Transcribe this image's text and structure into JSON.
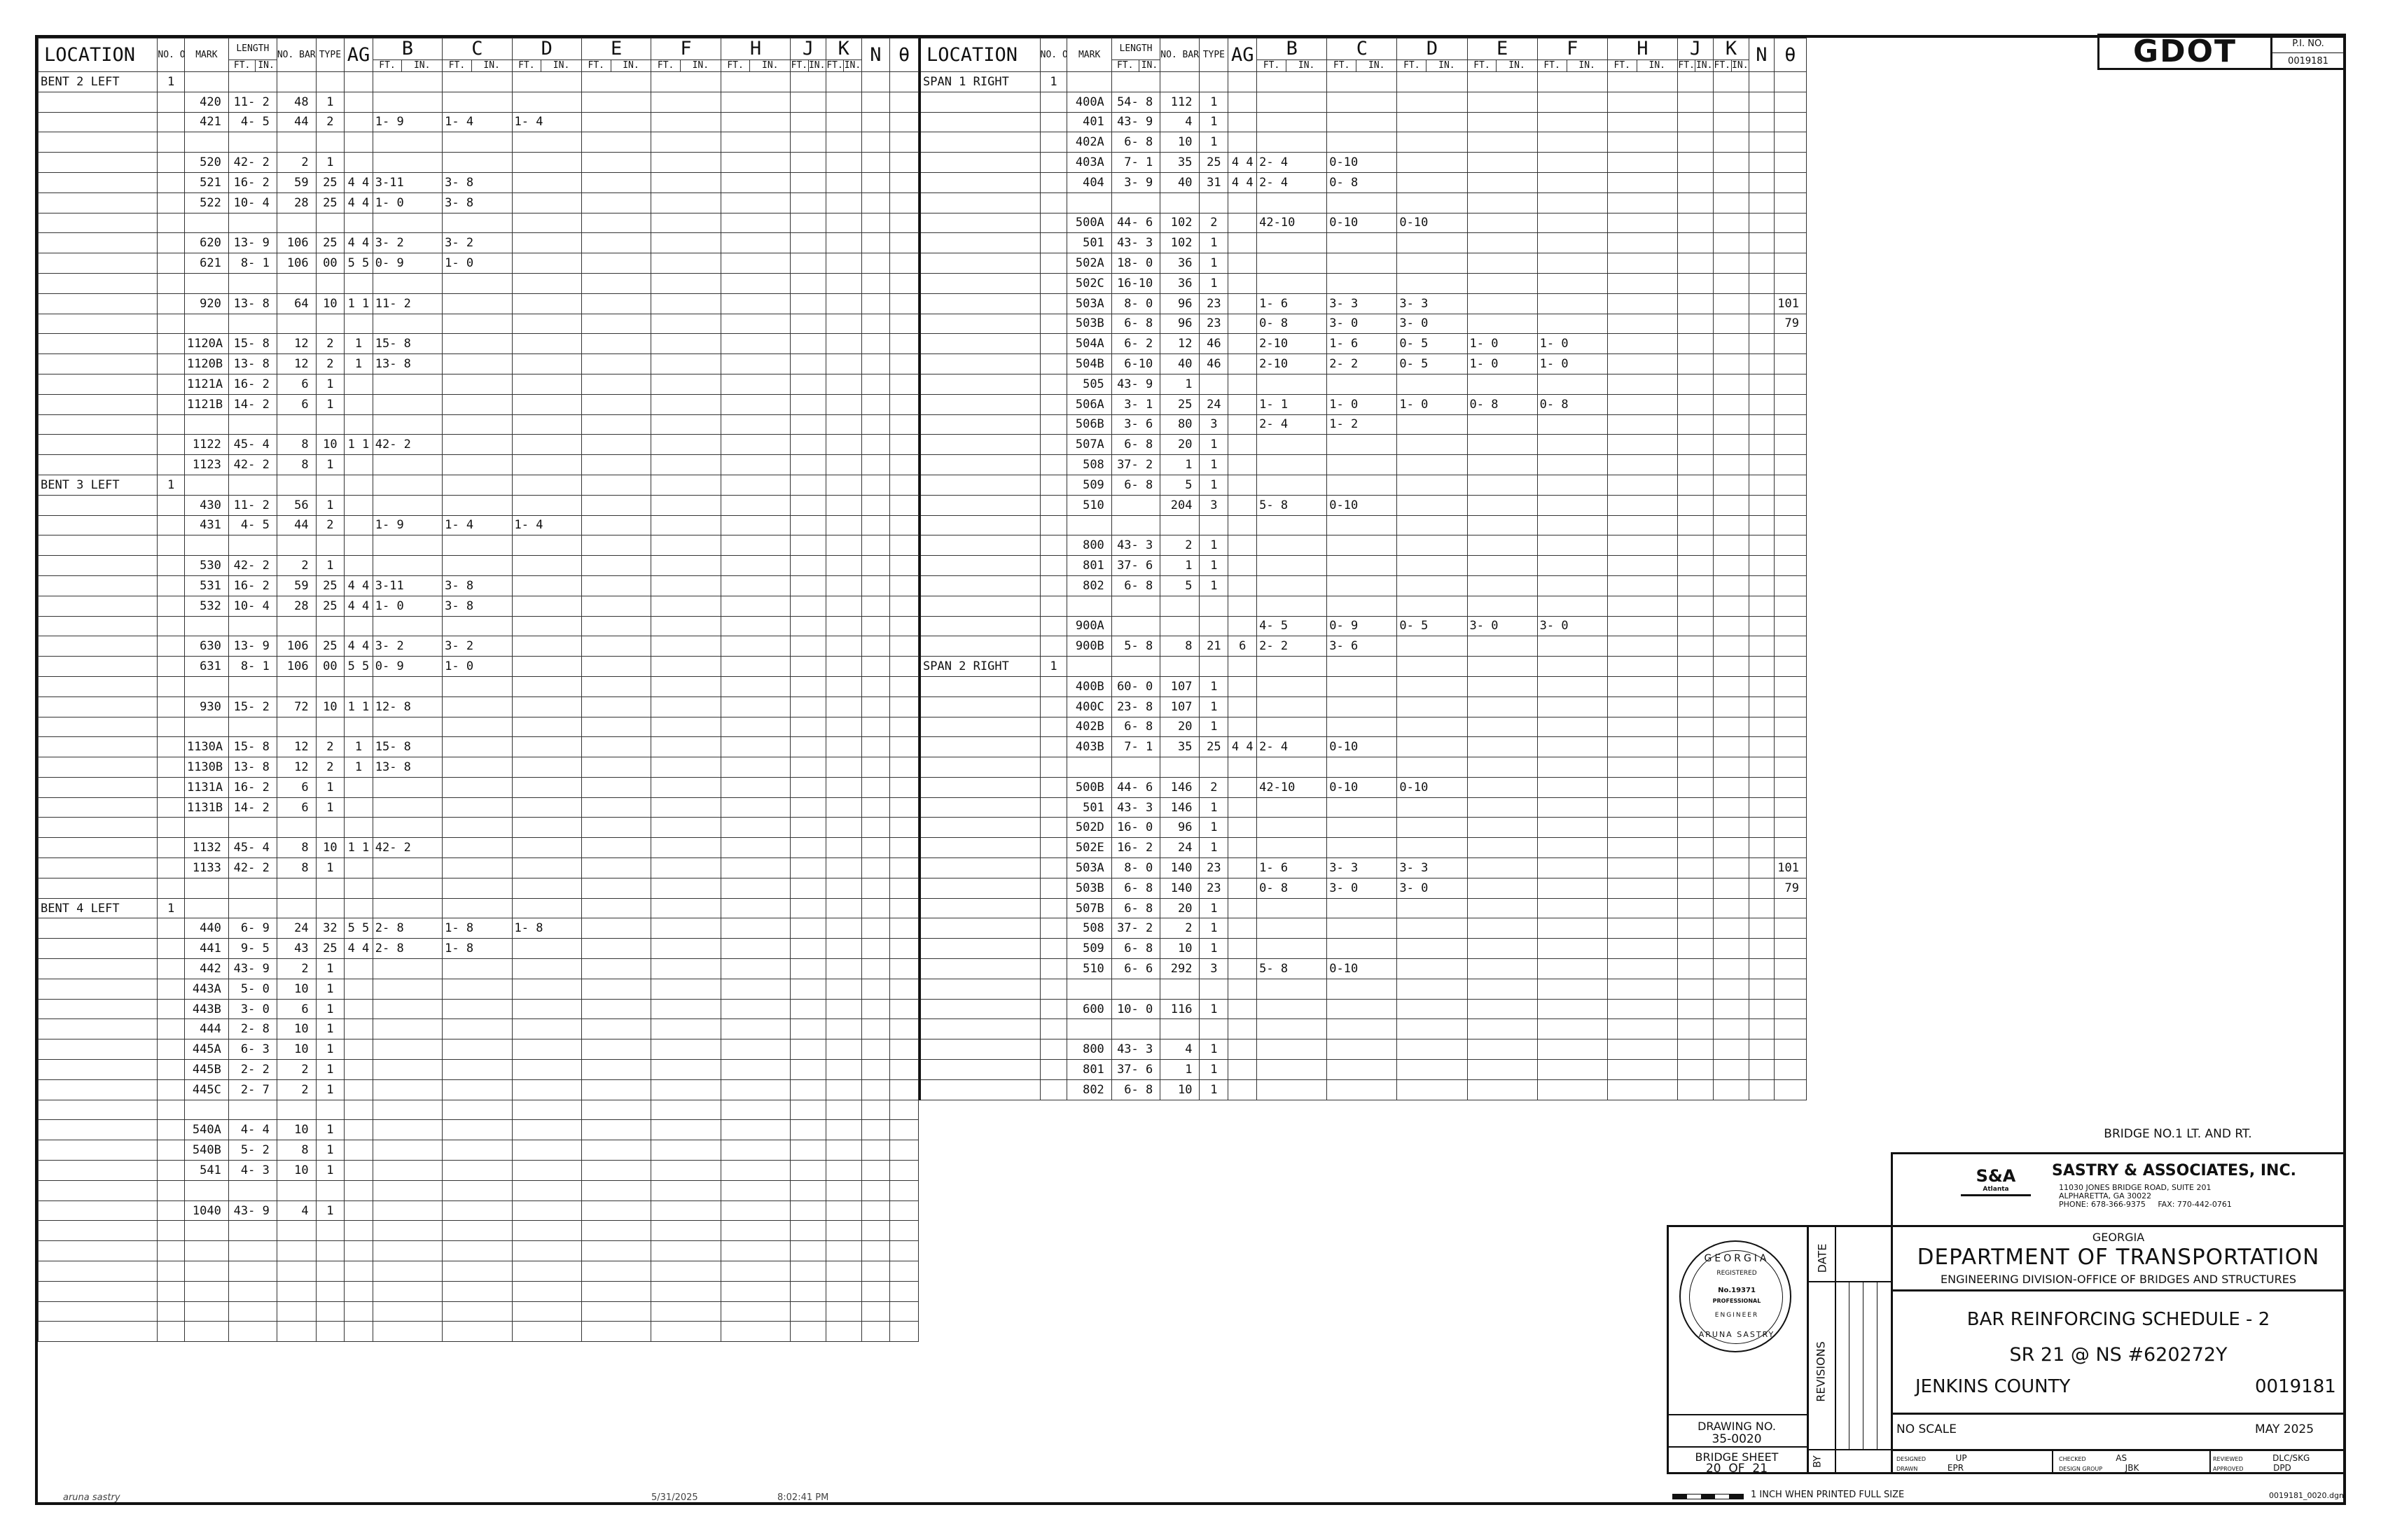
{
  "header": {
    "location": "LOCATION",
    "no_of_loc": "NO. OF LOC.",
    "mark": "MARK",
    "length": "LENGTH",
    "ft": "FT.",
    "in": "IN.",
    "no_bars": "NO. BARS REQ'D.",
    "type": "TYPE",
    "ag": "AG",
    "cols": [
      "B",
      "C",
      "D",
      "E",
      "F",
      "H",
      "J",
      "K"
    ],
    "n": "N",
    "theta": "θ"
  },
  "left_rows": [
    [
      "BENT 2 LEFT",
      "1",
      "",
      "",
      "",
      "",
      "",
      "",
      "",
      ""
    ],
    [
      "",
      "",
      "420",
      "11- 2",
      "48",
      "1",
      "",
      "",
      "",
      ""
    ],
    [
      "",
      "",
      "421",
      "4- 5",
      "44",
      "2",
      "",
      "1- 9",
      "1- 4",
      "1- 4"
    ],
    [
      "",
      "",
      "",
      "",
      "",
      "",
      "",
      "",
      "",
      ""
    ],
    [
      "",
      "",
      "520",
      "42- 2",
      "2",
      "1",
      "",
      "",
      "",
      ""
    ],
    [
      "",
      "",
      "521",
      "16- 2",
      "59",
      "25",
      "4 4",
      "3-11",
      "3- 8",
      ""
    ],
    [
      "",
      "",
      "522",
      "10- 4",
      "28",
      "25",
      "4 4",
      "1- 0",
      "3- 8",
      ""
    ],
    [
      "",
      "",
      "",
      "",
      "",
      "",
      "",
      "",
      "",
      ""
    ],
    [
      "",
      "",
      "620",
      "13- 9",
      "106",
      "25",
      "4 4",
      "3- 2",
      "3- 2",
      ""
    ],
    [
      "",
      "",
      "621",
      "8- 1",
      "106",
      "00",
      "5 5",
      "0- 9",
      "1- 0",
      ""
    ],
    [
      "",
      "",
      "",
      "",
      "",
      "",
      "",
      "",
      "",
      ""
    ],
    [
      "",
      "",
      "920",
      "13- 8",
      "64",
      "10",
      "1 1",
      "11- 2",
      "",
      ""
    ],
    [
      "",
      "",
      "",
      "",
      "",
      "",
      "",
      "",
      "",
      ""
    ],
    [
      "",
      "",
      "1120A",
      "15- 8",
      "12",
      "2",
      "1",
      "15- 8",
      "",
      ""
    ],
    [
      "",
      "",
      "1120B",
      "13- 8",
      "12",
      "2",
      "1",
      "13- 8",
      "",
      ""
    ],
    [
      "",
      "",
      "1121A",
      "16- 2",
      "6",
      "1",
      "",
      "",
      "",
      ""
    ],
    [
      "",
      "",
      "1121B",
      "14- 2",
      "6",
      "1",
      "",
      "",
      "",
      ""
    ],
    [
      "",
      "",
      "",
      "",
      "",
      "",
      "",
      "",
      "",
      ""
    ],
    [
      "",
      "",
      "1122",
      "45- 4",
      "8",
      "10",
      "1 1",
      "42- 2",
      "",
      ""
    ],
    [
      "",
      "",
      "1123",
      "42- 2",
      "8",
      "1",
      "",
      "",
      "",
      ""
    ],
    [
      "BENT 3 LEFT",
      "1",
      "",
      "",
      "",
      "",
      "",
      "",
      "",
      ""
    ],
    [
      "",
      "",
      "430",
      "11- 2",
      "56",
      "1",
      "",
      "",
      "",
      ""
    ],
    [
      "",
      "",
      "431",
      "4- 5",
      "44",
      "2",
      "",
      "1- 9",
      "1- 4",
      "1- 4"
    ],
    [
      "",
      "",
      "",
      "",
      "",
      "",
      "",
      "",
      "",
      ""
    ],
    [
      "",
      "",
      "530",
      "42- 2",
      "2",
      "1",
      "",
      "",
      "",
      ""
    ],
    [
      "",
      "",
      "531",
      "16- 2",
      "59",
      "25",
      "4 4",
      "3-11",
      "3- 8",
      ""
    ],
    [
      "",
      "",
      "532",
      "10- 4",
      "28",
      "25",
      "4 4",
      "1- 0",
      "3- 8",
      ""
    ],
    [
      "",
      "",
      "",
      "",
      "",
      "",
      "",
      "",
      "",
      ""
    ],
    [
      "",
      "",
      "630",
      "13- 9",
      "106",
      "25",
      "4 4",
      "3- 2",
      "3- 2",
      ""
    ],
    [
      "",
      "",
      "631",
      "8- 1",
      "106",
      "00",
      "5 5",
      "0- 9",
      "1- 0",
      ""
    ],
    [
      "",
      "",
      "",
      "",
      "",
      "",
      "",
      "",
      "",
      ""
    ],
    [
      "",
      "",
      "930",
      "15- 2",
      "72",
      "10",
      "1 1",
      "12- 8",
      "",
      ""
    ],
    [
      "",
      "",
      "",
      "",
      "",
      "",
      "",
      "",
      "",
      ""
    ],
    [
      "",
      "",
      "1130A",
      "15- 8",
      "12",
      "2",
      "1",
      "15- 8",
      "",
      ""
    ],
    [
      "",
      "",
      "1130B",
      "13- 8",
      "12",
      "2",
      "1",
      "13- 8",
      "",
      ""
    ],
    [
      "",
      "",
      "1131A",
      "16- 2",
      "6",
      "1",
      "",
      "",
      "",
      ""
    ],
    [
      "",
      "",
      "1131B",
      "14- 2",
      "6",
      "1",
      "",
      "",
      "",
      ""
    ],
    [
      "",
      "",
      "",
      "",
      "",
      "",
      "",
      "",
      "",
      ""
    ],
    [
      "",
      "",
      "1132",
      "45- 4",
      "8",
      "10",
      "1 1",
      "42- 2",
      "",
      ""
    ],
    [
      "",
      "",
      "1133",
      "42- 2",
      "8",
      "1",
      "",
      "",
      "",
      ""
    ],
    [
      "",
      "",
      "",
      "",
      "",
      "",
      "",
      "",
      "",
      ""
    ],
    [
      "BENT 4 LEFT",
      "1",
      "",
      "",
      "",
      "",
      "",
      "",
      "",
      ""
    ],
    [
      "",
      "",
      "440",
      "6- 9",
      "24",
      "32",
      "5 5",
      "2- 8",
      "1- 8",
      "1- 8"
    ],
    [
      "",
      "",
      "441",
      "9- 5",
      "43",
      "25",
      "4 4",
      "2- 8",
      "1- 8",
      ""
    ],
    [
      "",
      "",
      "442",
      "43- 9",
      "2",
      "1",
      "",
      "",
      "",
      ""
    ],
    [
      "",
      "",
      "443A",
      "5- 0",
      "10",
      "1",
      "",
      "",
      "",
      ""
    ],
    [
      "",
      "",
      "443B",
      "3- 0",
      "6",
      "1",
      "",
      "",
      "",
      ""
    ],
    [
      "",
      "",
      "444",
      "2- 8",
      "10",
      "1",
      "",
      "",
      "",
      ""
    ],
    [
      "",
      "",
      "445A",
      "6- 3",
      "10",
      "1",
      "",
      "",
      "",
      ""
    ],
    [
      "",
      "",
      "445B",
      "2- 2",
      "2",
      "1",
      "",
      "",
      "",
      ""
    ],
    [
      "",
      "",
      "445C",
      "2- 7",
      "2",
      "1",
      "",
      "",
      "",
      ""
    ],
    [
      "",
      "",
      "",
      "",
      "",
      "",
      "",
      "",
      "",
      ""
    ],
    [
      "",
      "",
      "540A",
      "4- 4",
      "10",
      "1",
      "",
      "",
      "",
      ""
    ],
    [
      "",
      "",
      "540B",
      "5- 2",
      "8",
      "1",
      "",
      "",
      "",
      ""
    ],
    [
      "",
      "",
      "541",
      "4- 3",
      "10",
      "1",
      "",
      "",
      "",
      ""
    ],
    [
      "",
      "",
      "",
      "",
      "",
      "",
      "",
      "",
      "",
      ""
    ],
    [
      "",
      "",
      "1040",
      "43- 9",
      "4",
      "1",
      "",
      "",
      "",
      ""
    ],
    [
      "",
      "",
      "",
      "",
      "",
      "",
      "",
      "",
      "",
      ""
    ],
    [
      "",
      "",
      "",
      "",
      "",
      "",
      "",
      "",
      "",
      ""
    ],
    [
      "",
      "",
      "",
      "",
      "",
      "",
      "",
      "",
      "",
      ""
    ],
    [
      "",
      "",
      "",
      "",
      "",
      "",
      "",
      "",
      "",
      ""
    ],
    [
      "",
      "",
      "",
      "",
      "",
      "",
      "",
      "",
      "",
      ""
    ],
    [
      "",
      "",
      "",
      "",
      "",
      "",
      "",
      "",
      "",
      ""
    ]
  ],
  "right_rows": [
    [
      "SPAN 1 RIGHT",
      "1",
      "",
      "",
      "",
      "",
      "",
      "",
      "",
      "",
      "",
      "",
      "",
      ""
    ],
    [
      "",
      "",
      "400A",
      "54- 8",
      "112",
      "1",
      "",
      "",
      "",
      "",
      "",
      "",
      "",
      ""
    ],
    [
      "",
      "",
      "401",
      "43- 9",
      "4",
      "1",
      "",
      "",
      "",
      "",
      "",
      "",
      "",
      ""
    ],
    [
      "",
      "",
      "402A",
      "6- 8",
      "10",
      "1",
      "",
      "",
      "",
      "",
      "",
      "",
      "",
      ""
    ],
    [
      "",
      "",
      "403A",
      "7- 1",
      "35",
      "25",
      "4 4",
      "2- 4",
      "0-10",
      "",
      "",
      "",
      "",
      ""
    ],
    [
      "",
      "",
      "404",
      "3- 9",
      "40",
      "31",
      "4 4",
      "2- 4",
      "0- 8",
      "",
      "",
      "",
      "",
      ""
    ],
    [
      "",
      "",
      "",
      "",
      "",
      "",
      "",
      "",
      "",
      "",
      "",
      "",
      "",
      ""
    ],
    [
      "",
      "",
      "500A",
      "44- 6",
      "102",
      "2",
      "",
      "42-10",
      "0-10",
      "0-10",
      "",
      "",
      "",
      ""
    ],
    [
      "",
      "",
      "501",
      "43- 3",
      "102",
      "1",
      "",
      "",
      "",
      "",
      "",
      "",
      "",
      ""
    ],
    [
      "",
      "",
      "502A",
      "18- 0",
      "36",
      "1",
      "",
      "",
      "",
      "",
      "",
      "",
      "",
      ""
    ],
    [
      "",
      "",
      "502C",
      "16-10",
      "36",
      "1",
      "",
      "",
      "",
      "",
      "",
      "",
      "",
      ""
    ],
    [
      "",
      "",
      "503A",
      "8- 0",
      "96",
      "23",
      "",
      "1- 6",
      "3- 3",
      "3- 3",
      "",
      "",
      "",
      "101"
    ],
    [
      "",
      "",
      "503B",
      "6- 8",
      "96",
      "23",
      "",
      "0- 8",
      "3- 0",
      "3- 0",
      "",
      "",
      "",
      "79"
    ],
    [
      "",
      "",
      "504A",
      "6- 2",
      "12",
      "46",
      "",
      "2-10",
      "1- 6",
      "0- 5",
      "1- 0",
      "1- 0",
      "",
      ""
    ],
    [
      "",
      "",
      "504B",
      "6-10",
      "40",
      "46",
      "",
      "2-10",
      "2- 2",
      "0- 5",
      "1- 0",
      "1- 0",
      "",
      ""
    ],
    [
      "",
      "",
      "505",
      "43- 9",
      "1",
      "",
      "",
      "",
      "",
      "",
      "",
      "",
      "",
      ""
    ],
    [
      "",
      "",
      "506A",
      "3- 1",
      "25",
      "24",
      "",
      "1- 1",
      "1- 0",
      "1- 0",
      "0- 8",
      "0- 8",
      "",
      ""
    ],
    [
      "",
      "",
      "506B",
      "3- 6",
      "80",
      "3",
      "",
      "2- 4",
      "1- 2",
      "",
      "",
      "",
      "",
      ""
    ],
    [
      "",
      "",
      "507A",
      "6- 8",
      "20",
      "1",
      "",
      "",
      "",
      "",
      "",
      "",
      "",
      ""
    ],
    [
      "",
      "",
      "508",
      "37- 2",
      "1",
      "1",
      "",
      "",
      "",
      "",
      "",
      "",
      "",
      ""
    ],
    [
      "",
      "",
      "509",
      "6- 8",
      "5",
      "1",
      "",
      "",
      "",
      "",
      "",
      "",
      "",
      ""
    ],
    [
      "",
      "",
      "510",
      "",
      "204",
      "3",
      "",
      "5- 8",
      "0-10",
      "",
      "",
      "",
      "",
      ""
    ],
    [
      "",
      "",
      "",
      "",
      "",
      "",
      "",
      "",
      "",
      "",
      "",
      "",
      "",
      ""
    ],
    [
      "",
      "",
      "800",
      "43- 3",
      "2",
      "1",
      "",
      "",
      "",
      "",
      "",
      "",
      "",
      ""
    ],
    [
      "",
      "",
      "801",
      "37- 6",
      "1",
      "1",
      "",
      "",
      "",
      "",
      "",
      "",
      "",
      ""
    ],
    [
      "",
      "",
      "802",
      "6- 8",
      "5",
      "1",
      "",
      "",
      "",
      "",
      "",
      "",
      "",
      ""
    ],
    [
      "",
      "",
      "",
      "",
      "",
      "",
      "",
      "",
      "",
      "",
      "",
      "",
      "",
      ""
    ],
    [
      "",
      "",
      "900A",
      "",
      "",
      "",
      "",
      "4- 5",
      "0- 9",
      "0- 5",
      "3- 0",
      "3- 0",
      "",
      ""
    ],
    [
      "",
      "",
      "900B",
      "5- 8",
      "8",
      "21",
      "6",
      "2- 2",
      "3- 6",
      "",
      "",
      "",
      "",
      ""
    ],
    [
      "SPAN 2 RIGHT",
      "1",
      "",
      "",
      "",
      "",
      "",
      "",
      "",
      "",
      "",
      "",
      "",
      ""
    ],
    [
      "",
      "",
      "400B",
      "60- 0",
      "107",
      "1",
      "",
      "",
      "",
      "",
      "",
      "",
      "",
      ""
    ],
    [
      "",
      "",
      "400C",
      "23- 8",
      "107",
      "1",
      "",
      "",
      "",
      "",
      "",
      "",
      "",
      ""
    ],
    [
      "",
      "",
      "402B",
      "6- 8",
      "20",
      "1",
      "",
      "",
      "",
      "",
      "",
      "",
      "",
      ""
    ],
    [
      "",
      "",
      "403B",
      "7- 1",
      "35",
      "25",
      "4 4",
      "2- 4",
      "0-10",
      "",
      "",
      "",
      "",
      ""
    ],
    [
      "",
      "",
      "",
      "",
      "",
      "",
      "",
      "",
      "",
      "",
      "",
      "",
      "",
      ""
    ],
    [
      "",
      "",
      "500B",
      "44- 6",
      "146",
      "2",
      "",
      "42-10",
      "0-10",
      "0-10",
      "",
      "",
      "",
      ""
    ],
    [
      "",
      "",
      "501",
      "43- 3",
      "146",
      "1",
      "",
      "",
      "",
      "",
      "",
      "",
      "",
      ""
    ],
    [
      "",
      "",
      "502D",
      "16- 0",
      "96",
      "1",
      "",
      "",
      "",
      "",
      "",
      "",
      "",
      ""
    ],
    [
      "",
      "",
      "502E",
      "16- 2",
      "24",
      "1",
      "",
      "",
      "",
      "",
      "",
      "",
      "",
      ""
    ],
    [
      "",
      "",
      "503A",
      "8- 0",
      "140",
      "23",
      "",
      "1- 6",
      "3- 3",
      "3- 3",
      "",
      "",
      "",
      "101"
    ],
    [
      "",
      "",
      "503B",
      "6- 8",
      "140",
      "23",
      "",
      "0- 8",
      "3- 0",
      "3- 0",
      "",
      "",
      "",
      "79"
    ],
    [
      "",
      "",
      "507B",
      "6- 8",
      "20",
      "1",
      "",
      "",
      "",
      "",
      "",
      "",
      "",
      ""
    ],
    [
      "",
      "",
      "508",
      "37- 2",
      "2",
      "1",
      "",
      "",
      "",
      "",
      "",
      "",
      "",
      ""
    ],
    [
      "",
      "",
      "509",
      "6- 8",
      "10",
      "1",
      "",
      "",
      "",
      "",
      "",
      "",
      "",
      ""
    ],
    [
      "",
      "",
      "510",
      "6- 6",
      "292",
      "3",
      "",
      "5- 8",
      "0-10",
      "",
      "",
      "",
      "",
      ""
    ],
    [
      "",
      "",
      "",
      "",
      "",
      "",
      "",
      "",
      "",
      "",
      "",
      "",
      "",
      ""
    ],
    [
      "",
      "",
      "600",
      "10- 0",
      "116",
      "1",
      "",
      "",
      "",
      "",
      "",
      "",
      "",
      ""
    ],
    [
      "",
      "",
      "",
      "",
      "",
      "",
      "",
      "",
      "",
      "",
      "",
      "",
      "",
      ""
    ],
    [
      "",
      "",
      "800",
      "43- 3",
      "4",
      "1",
      "",
      "",
      "",
      "",
      "",
      "",
      "",
      ""
    ],
    [
      "",
      "",
      "801",
      "37- 6",
      "1",
      "1",
      "",
      "",
      "",
      "",
      "",
      "",
      "",
      ""
    ],
    [
      "",
      "",
      "802",
      "6- 8",
      "10",
      "1",
      "",
      "",
      "",
      "",
      "",
      "",
      "",
      ""
    ]
  ],
  "gdot": "GDOT",
  "pj_label": "P.I. NO.",
  "pj_no": "0019181",
  "title_block": {
    "bridge": "BRIDGE NO.1 LT. AND RT.",
    "firm": "SASTRY & ASSOCIATES, INC.",
    "firm_logo": "S&A",
    "firm_logo_sub": "Atlanta",
    "firm_addr1": "11030 JONES BRIDGE ROAD, SUITE 201",
    "firm_addr2": "ALPHARETTA, GA 30022",
    "firm_phone": "PHONE: 678-366-9375     FAX: 770-442-0761",
    "state": "GEORGIA",
    "dept": "DEPARTMENT OF TRANSPORTATION",
    "division": "ENGINEERING DIVISION-OFFICE OF BRIDGES AND STRUCTURES",
    "sheet_title": "BAR REINFORCING SCHEDULE - 2",
    "route": "SR 21 @ NS #620272Y",
    "county": "JENKINS COUNTY",
    "pi": "0019181",
    "scale": "NO SCALE",
    "date": "MAY 2025",
    "drawing_label": "DRAWING NO.",
    "drawing_no": "35-0020",
    "sheet_label": "BRIDGE SHEET",
    "sheet_no": "20  OF  21",
    "revisions": "REVISIONS",
    "date_col": "DATE",
    "by_col": "BY",
    "designed_label": "DESIGNED",
    "designed": "UP",
    "drawn_label": "DRAWN",
    "drawn": "EPR",
    "checked_label": "CHECKED",
    "checked": "AS",
    "design_group_label": "DESIGN GROUP",
    "design_group": "JBK",
    "reviewed_label": "REVIEWED",
    "reviewed": "DLC/SKG",
    "approved_label": "APPROVED",
    "approved": "DPD",
    "bar_scale": "1 INCH WHEN PRINTED FULL SIZE",
    "file": "0019181_0020.dgn",
    "seal_top": "GEORGIA",
    "seal_reg": "REGISTERED",
    "seal_no": "No.19371",
    "seal_prof": "PROFESSIONAL",
    "seal_eng": "ENGINEER",
    "seal_name": "ARUNA SASTRY"
  },
  "footer": {
    "user": "aruna sastry",
    "date": "5/31/2025",
    "time": "8:02:41 PM"
  }
}
